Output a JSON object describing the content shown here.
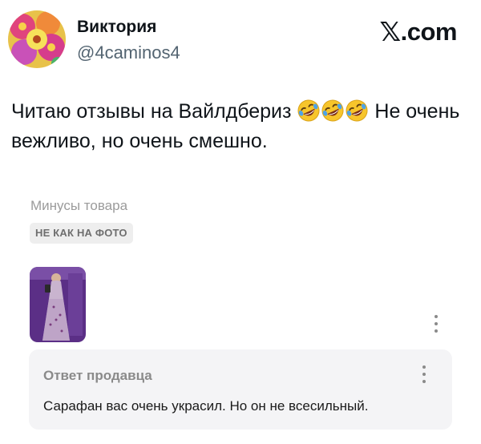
{
  "tweet": {
    "author_name": "Виктория",
    "author_handle": "@4caminos4",
    "avatar_icon": "flower-avatar",
    "text_before": "Читаю отзывы на Вайлдбериз",
    "emoji_name": "rolling-on-floor-laughing-emoji",
    "emoji_count": 3,
    "text_after": " Не очень вежливо, но очень смешно."
  },
  "brand": {
    "x_mark": "𝕏",
    "suffix": ".com"
  },
  "review": {
    "cons_label": "Минусы товара",
    "cons_tag": "НЕ КАК НА ФОТО",
    "photo_icon": "dress-photo-thumbnail",
    "more_icon": "more-vertical-icon"
  },
  "seller_reply": {
    "title": "Ответ продавца",
    "text": "Сарафан вас очень украсил. Но он не всесильный.",
    "more_icon": "more-vertical-icon"
  }
}
